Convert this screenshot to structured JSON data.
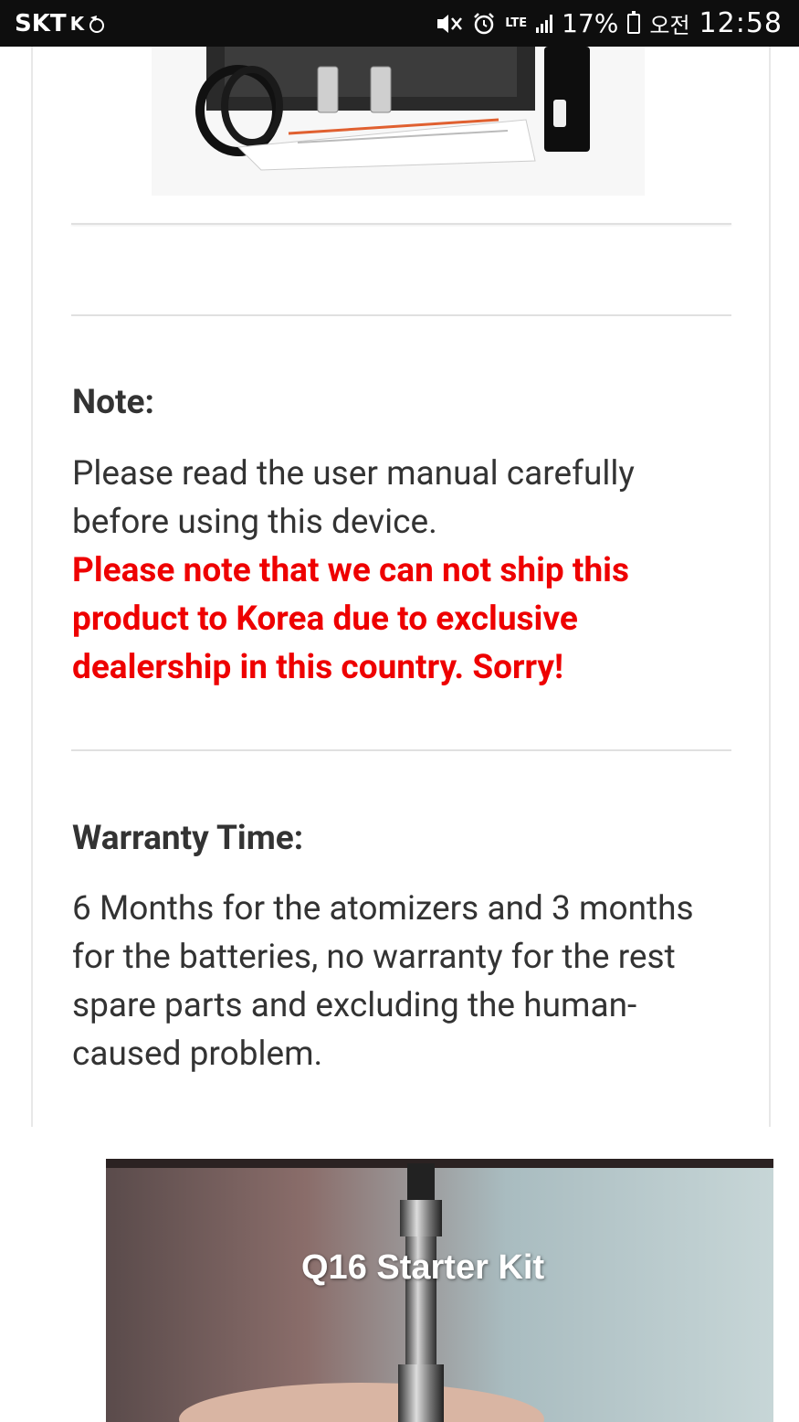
{
  "status_bar": {
    "carrier": "SKT",
    "carrier_badge": "K",
    "network": "LTE",
    "battery_percent": "17%",
    "ampm": "오전",
    "time": "12:58"
  },
  "note": {
    "heading": "Note:",
    "body": "Please read the user manual carefully before using this device.",
    "warning": "Please note that we can not ship this product to Korea due to exclusive dealership in this country. Sorry!"
  },
  "warranty": {
    "heading": "Warranty Time:",
    "body": "6 Months for the atomizers and 3 months for the batteries, no warranty for the rest spare parts and excluding the human-caused problem."
  },
  "banner": {
    "title": "Q16 Starter Kit"
  },
  "colors": {
    "warning": "#ee0000",
    "text": "#333333",
    "status_bar": "#0e0e0e"
  }
}
